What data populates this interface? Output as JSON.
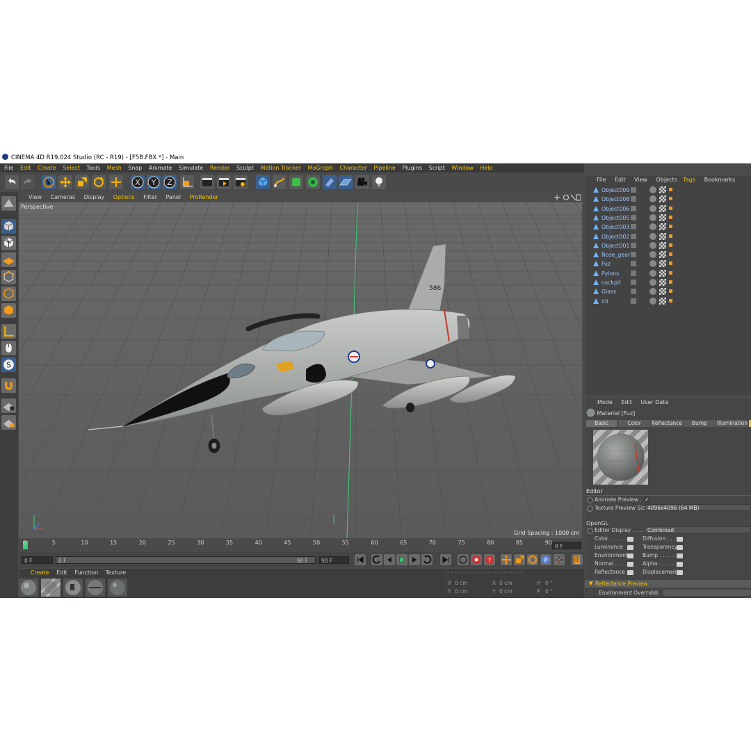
{
  "window": {
    "title": "CINEMA 4D R19.024 Studio (RC - R19) - [F5B.FBX *] - Main"
  },
  "menubar": {
    "items": [
      "File",
      "Edit",
      "Create",
      "Select",
      "Tools",
      "Mesh",
      "Snap",
      "Animate",
      "Simulate",
      "Render",
      "Sculpt",
      "Motion Tracker",
      "MoGraph",
      "Character",
      "Pipeline",
      "Plugins",
      "Script",
      "Window",
      "Help"
    ]
  },
  "viewport": {
    "menu": [
      "View",
      "Cameras",
      "Display",
      "Options",
      "Filter",
      "Panel",
      "ProRender"
    ],
    "label": "Perspective",
    "grid_spacing": "Grid Spacing : 1000 cm",
    "tail_number": "586"
  },
  "timeline": {
    "ticks": [
      "0",
      "5",
      "10",
      "15",
      "20",
      "25",
      "30",
      "35",
      "40",
      "45",
      "50",
      "55",
      "60",
      "65",
      "70",
      "75",
      "80",
      "85",
      "90"
    ],
    "end_field": "0 F"
  },
  "transport": {
    "current_frame": "0 F",
    "range_start": "0 F",
    "range_end": "90 F",
    "max_frame": "90 F"
  },
  "material_manager": {
    "menu": [
      "Create",
      "Edit",
      "Function",
      "Texture"
    ]
  },
  "coordinates": {
    "rows": [
      {
        "a": "X",
        "av": "0 cm",
        "b": "X",
        "bv": "0 cm",
        "c": "H",
        "cv": "0 °"
      },
      {
        "a": "Y",
        "av": "0 cm",
        "b": "Y",
        "bv": "0 cm",
        "c": "P",
        "cv": "0 °"
      }
    ]
  },
  "object_manager": {
    "menu": [
      "File",
      "Edit",
      "View",
      "Objects",
      "Tags",
      "Bookmarks"
    ],
    "objects": [
      "Object009",
      "Object008",
      "Object006",
      "Object005",
      "Object003",
      "Object002",
      "Object001",
      "Nose_gear",
      "Fuz",
      "Pylons",
      "cockpit",
      "Glass",
      "int"
    ]
  },
  "attributes": {
    "menu": [
      "Mode",
      "Edit",
      "User Data"
    ],
    "material_name": "Material [Fuz]",
    "tabs": [
      "Basic",
      "Color",
      "Reflectance",
      "Bump",
      "Illumination"
    ],
    "editor_title": "Editor",
    "animate_preview": "Animate Preview . . .",
    "texture_preview_size_label": "Texture Preview Size",
    "texture_preview_size_value": "4096x4096 (64 MB)",
    "opengl_title": "OpenGL",
    "editor_display_label": "Editor Display . . . . . .",
    "editor_display_value": "Combined",
    "channels_left": [
      "Color . . . . .",
      "Luminance",
      "Environment",
      "Normal . . . .",
      "Reflectance"
    ],
    "channels_right": [
      "Diffusion . . .",
      "Transparency",
      "Bump . . . . . .",
      "Alpha . . . . . .",
      "Displacement"
    ],
    "reflectance_preview": "Reflectance Preview",
    "environment_override": "Environment Override"
  },
  "colors": {
    "accent": "#f4c400",
    "panel": "#4b4b4b",
    "object_text": "#9fc7ff"
  }
}
